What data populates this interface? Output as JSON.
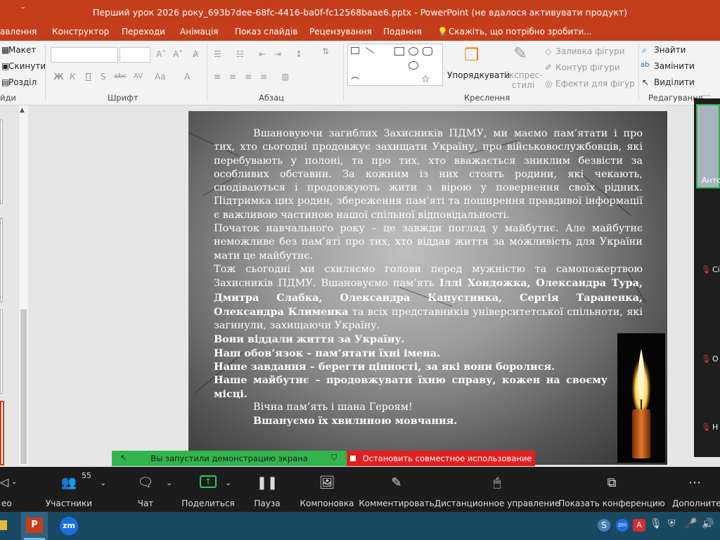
{
  "window": {
    "title": "Перший урок 2026 року_693b7dee-68fc-4416-ba0f-fc12568baae6.pptx  -  PowerPoint (не вдалося активувати продукт)",
    "quick_access": "⁼"
  },
  "tabs": [
    "авлення",
    "Конструктор",
    "Переходи",
    "Анімація",
    "Показ слайдів",
    "Рецензування",
    "Подання"
  ],
  "tellme": "Скажіть, що потрібно зробити...",
  "ribbon": {
    "slides": {
      "layout": "Макет",
      "reset": "Скинути",
      "section": "Розділ",
      "label": "йди"
    },
    "font": {
      "label": "Шрифт",
      "bold": "Ж",
      "italic": "К",
      "underline": "П",
      "shadow": "S",
      "strike": "abc",
      "spacing": "AV",
      "case": "Aa",
      "color": "A"
    },
    "paragraph": {
      "label": "Абзац"
    },
    "drawing": {
      "label": "Креслення",
      "arrange": "Упорядкувати",
      "styles": "Експрес-стилі",
      "fill": "Заливка фігури",
      "outline": "Контур фігури",
      "effects": "Ефекти для фігур"
    },
    "editing": {
      "label": "Редагування",
      "find": "Знайти",
      "replace": "Замінити",
      "select": "Виділити"
    }
  },
  "slide": {
    "p1": "Вшановуючи загиблих Захисників ПДМУ, ми маємо пам’ятати і про тих, хто сьогодні продовжує захищати Україну, про військовослужбовців, які перебувають у полоні, та про тих, хто вважається зниклим безвісти за особливих обставин. За кожним із них стоять родини, які чекають, сподіваються і продовжують жити з вірою у повернення своїх рідних. Підтримка цих родин, збереження пам’яті та поширення правдивої інформації є важливою частиною нашої спільної відповідальності.",
    "p2": "Початок навчального року – це завжди погляд у майбутнє. Але майбутнє неможливе без пам’яті про тих, хто віддав життя за можливість для України мати це майбутнє.",
    "p3a": "Тож сьогодні ми схиляємо голови перед мужністю та самопожертвою Захисників ПДМУ. Вшановуємо пам’ять ",
    "p3b": "Іллі Хондожка, Олександра Тура, Дмитра Слабка, Олександра Капустника, Сергія Тараненка, Олександра Клименка",
    "p3c": " та всіх представників університетської спільноти, які загинули, захищаючи Україну.",
    "b1": "Вони віддали життя за Україну.",
    "b2": "Наш обов’язок – пам’ятати їхні імена.",
    "b3": "Наше завдання – берегти цінності, за які вони боролися.",
    "b4": "Наше майбутнє – продовжувати їхню справу, кожен на своєму місці.",
    "p4": "Вічна пам’ять і шана Героям!",
    "p5": "Вшануємо їх хвилиною мовчання."
  },
  "share": {
    "running": "Вы запустили демонстрацию экрана",
    "stop": "Остановить совместное использование"
  },
  "zoom": {
    "participants_count": "55",
    "items": [
      "ео",
      "Участники",
      "Чат",
      "Поделиться",
      "Пауза",
      "Компоновка",
      "Комментировать",
      "Дистанционное управление",
      "Показать конференцию",
      "Дополнител"
    ],
    "people": [
      "Анто",
      "Сі",
      "О",
      "Н"
    ]
  },
  "colors": {
    "accent": "#c43e1c",
    "zoom_green": "#33b54e",
    "zoom_red": "#e02020"
  }
}
